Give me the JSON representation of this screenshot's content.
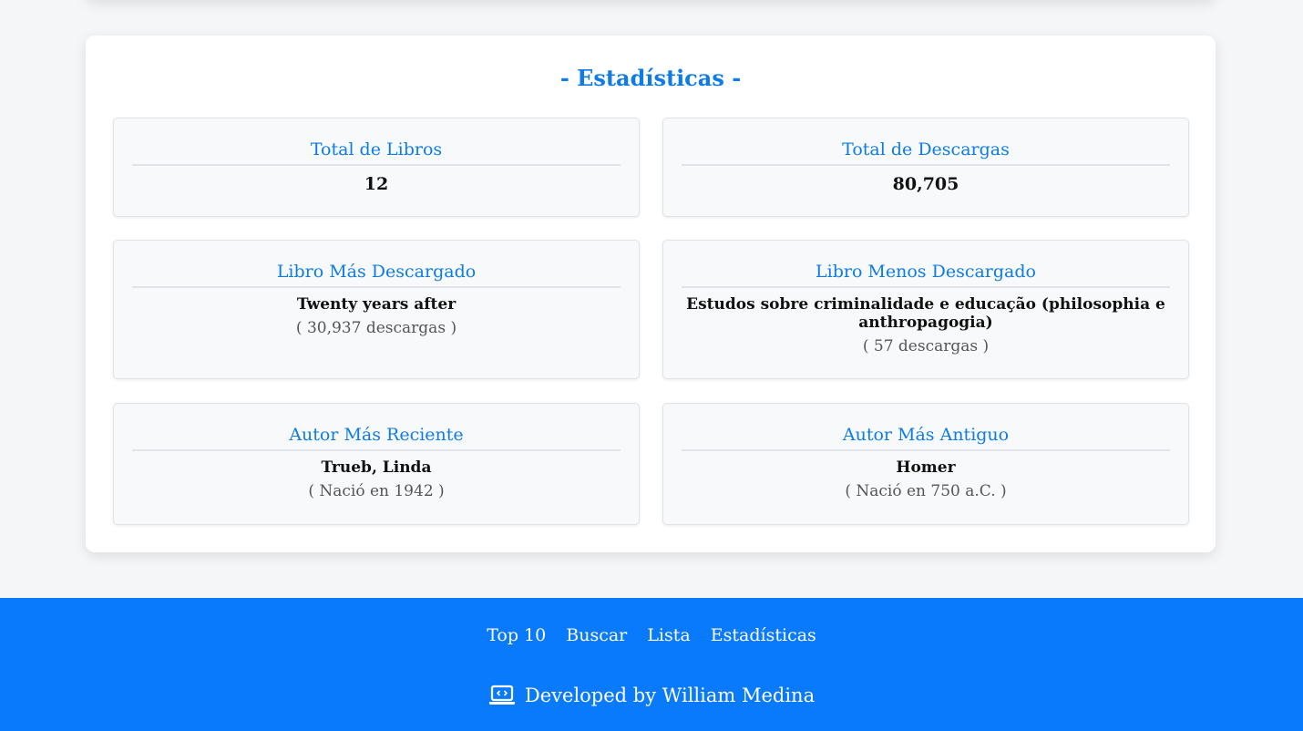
{
  "stats": {
    "title": "- Estadísticas -",
    "total_books": {
      "label": "Total de Libros",
      "value": "12"
    },
    "total_downloads": {
      "label": "Total de Descargas",
      "value": "80,705"
    },
    "most_downloaded": {
      "label": "Libro Más Descargado",
      "book": "Twenty years after",
      "detail": "( 30,937 descargas )"
    },
    "least_downloaded": {
      "label": "Libro Menos Descargado",
      "book": "Estudos sobre criminalidade e educação (philosophia e anthropagogia)",
      "detail": "( 57 descargas )"
    },
    "newest_author": {
      "label": "Autor Más Reciente",
      "name": "Trueb, Linda",
      "detail": "( Nació en 1942 )"
    },
    "oldest_author": {
      "label": "Autor Más Antiguo",
      "name": "Homer",
      "detail": "( Nació en 750 a.C. )"
    }
  },
  "footer": {
    "nav": [
      "Top 10",
      "Buscar",
      "Lista",
      "Estadísticas"
    ],
    "credit": "Developed by William Medina",
    "credit_icon": "laptop-code-icon"
  },
  "colors": {
    "accent": "#0d7ce8",
    "footer_bg": "#0a7afc",
    "page_bg": "#f5f6f8"
  }
}
